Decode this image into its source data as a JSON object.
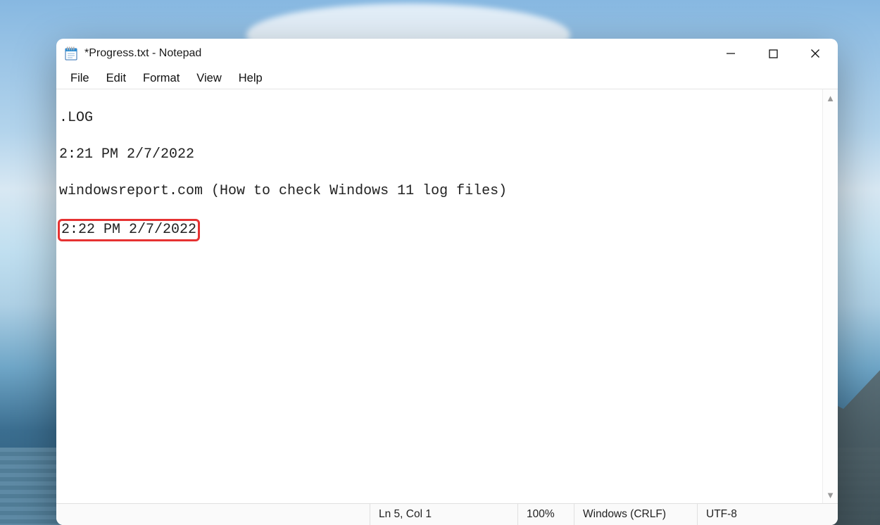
{
  "window": {
    "title": "*Progress.txt - Notepad",
    "controls": {
      "minimize": "minimize-button",
      "maximize": "maximize-button",
      "close": "close-button"
    }
  },
  "menubar": {
    "file": "File",
    "edit": "Edit",
    "format": "Format",
    "view": "View",
    "help": "Help"
  },
  "editor": {
    "line1": ".LOG",
    "line2": "2:21 PM 2/7/2022",
    "line3": "windowsreport.com (How to check Windows 11 log files)",
    "line4_highlighted": "2:22 PM 2/7/2022"
  },
  "statusbar": {
    "position": "Ln 5, Col 1",
    "zoom": "100%",
    "line_ending": "Windows (CRLF)",
    "encoding": "UTF-8"
  }
}
